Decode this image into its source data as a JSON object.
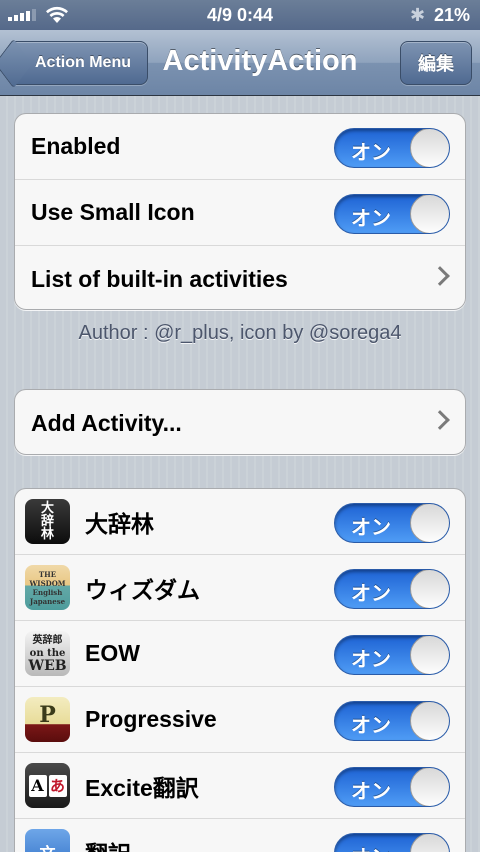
{
  "status_bar": {
    "time": "4/9 0:44",
    "battery": "21%",
    "signal_icon": "signal-bars-icon",
    "wifi_icon": "wifi-icon",
    "bluetooth_icon": "bluetooth-icon"
  },
  "nav": {
    "back_label": "Action Menu",
    "title": "ActivityAction",
    "edit_label": "編集"
  },
  "settings": {
    "rows": [
      {
        "label": "Enabled",
        "toggle": "オン",
        "on": true
      },
      {
        "label": "Use Small Icon",
        "toggle": "オン",
        "on": true
      },
      {
        "label": "List of built-in activities"
      }
    ]
  },
  "footer": "Author : @r_plus, icon by @sorega4",
  "add_activity": {
    "label": "Add Activity..."
  },
  "activities": [
    {
      "name": "大辞林",
      "toggle": "オン",
      "on": true,
      "icon": "daijirin-icon",
      "icon_text": [
        "大",
        "辞",
        "林"
      ]
    },
    {
      "name": "ウィズダム",
      "toggle": "オン",
      "on": true,
      "icon": "wisdom-icon",
      "icon_text": [
        "THE",
        "WISDOM",
        "English",
        "Japanese"
      ]
    },
    {
      "name": "EOW",
      "toggle": "オン",
      "on": true,
      "icon": "eow-icon",
      "icon_text": [
        "英辞郎",
        "on the",
        "WEB"
      ]
    },
    {
      "name": "Progressive",
      "toggle": "オン",
      "on": true,
      "icon": "progressive-icon",
      "icon_text": [
        "P"
      ]
    },
    {
      "name": "Excite翻訳",
      "toggle": "オン",
      "on": true,
      "icon": "excite-icon",
      "icon_text": [
        "A",
        "あ"
      ]
    },
    {
      "name": "翻訳",
      "toggle": "オン",
      "on": true,
      "icon": "translate-icon",
      "icon_text": [
        "文"
      ]
    }
  ],
  "colors": {
    "nav_bar": "#7b92b0",
    "toggle_on": "#2f78e4",
    "background": "#c5ccd4"
  }
}
